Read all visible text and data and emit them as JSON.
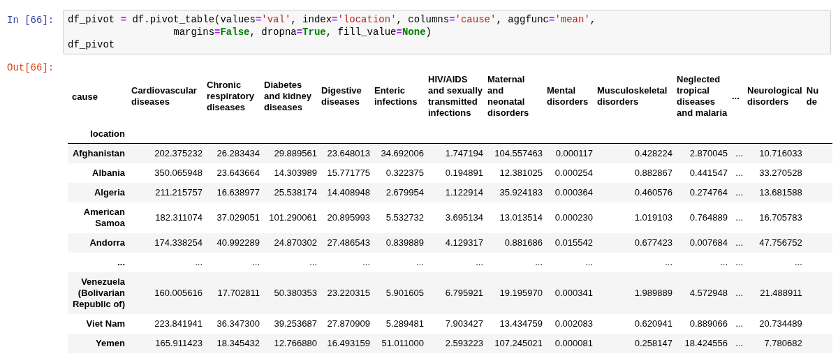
{
  "input_prompt": "In [66]:",
  "code_lines": [
    [
      {
        "kind": "plain",
        "text": "df_pivot "
      },
      {
        "kind": "op",
        "text": "="
      },
      {
        "kind": "plain",
        "text": " df.pivot_table(values"
      },
      {
        "kind": "op",
        "text": "="
      },
      {
        "kind": "str",
        "text": "'val'"
      },
      {
        "kind": "plain",
        "text": ", index"
      },
      {
        "kind": "op",
        "text": "="
      },
      {
        "kind": "str",
        "text": "'location'"
      },
      {
        "kind": "plain",
        "text": ", columns"
      },
      {
        "kind": "op",
        "text": "="
      },
      {
        "kind": "str",
        "text": "'cause'"
      },
      {
        "kind": "plain",
        "text": ", aggfunc"
      },
      {
        "kind": "op",
        "text": "="
      },
      {
        "kind": "str",
        "text": "'mean'"
      },
      {
        "kind": "plain",
        "text": ","
      }
    ],
    [
      {
        "kind": "plain",
        "text": "                  margins"
      },
      {
        "kind": "op",
        "text": "="
      },
      {
        "kind": "kw",
        "text": "False"
      },
      {
        "kind": "plain",
        "text": ", dropna"
      },
      {
        "kind": "op",
        "text": "="
      },
      {
        "kind": "kw",
        "text": "True"
      },
      {
        "kind": "plain",
        "text": ", fill_value"
      },
      {
        "kind": "op",
        "text": "="
      },
      {
        "kind": "kw",
        "text": "None"
      },
      {
        "kind": "plain",
        "text": ")"
      }
    ],
    [
      {
        "kind": "plain",
        "text": "df_pivot"
      }
    ]
  ],
  "output_prompt": "Out[66]:",
  "table": {
    "columns_name": "cause",
    "index_name": "location",
    "columns": [
      "Cardiovascular diseases",
      "Chronic respiratory diseases",
      "Diabetes and kidney diseases",
      "Digestive diseases",
      "Enteric infections",
      "HIV/AIDS and sexually transmitted infections",
      "Maternal and neonatal disorders",
      "Mental disorders",
      "Musculoskeletal disorders",
      "Neglected tropical diseases and malaria",
      "...",
      "Neurological disorders",
      "Nu de"
    ],
    "rows": [
      {
        "location": "Afghanistan",
        "values": [
          "202.375232",
          "26.283434",
          "29.889561",
          "23.648013",
          "34.692006",
          "1.747194",
          "104.557463",
          "0.000117",
          "0.428224",
          "2.870045",
          "...",
          "10.716033"
        ]
      },
      {
        "location": "Albania",
        "values": [
          "350.065948",
          "23.643664",
          "14.303989",
          "15.771775",
          "0.322375",
          "0.194891",
          "12.381025",
          "0.000254",
          "0.882867",
          "0.441547",
          "...",
          "33.270528"
        ]
      },
      {
        "location": "Algeria",
        "values": [
          "211.215757",
          "16.638977",
          "25.538174",
          "14.408948",
          "2.679954",
          "1.122914",
          "35.924183",
          "0.000364",
          "0.460576",
          "0.274764",
          "...",
          "13.681588"
        ]
      },
      {
        "location": "American Samoa",
        "values": [
          "182.311074",
          "37.029051",
          "101.290061",
          "20.895993",
          "5.532732",
          "3.695134",
          "13.013514",
          "0.000230",
          "1.019103",
          "0.764889",
          "...",
          "16.705783"
        ]
      },
      {
        "location": "Andorra",
        "values": [
          "174.338254",
          "40.992289",
          "24.870302",
          "27.486543",
          "0.839889",
          "4.129317",
          "0.881686",
          "0.015542",
          "0.677423",
          "0.007684",
          "...",
          "47.756752"
        ]
      },
      {
        "location": "...",
        "values": [
          "...",
          "...",
          "...",
          "...",
          "...",
          "...",
          "...",
          "...",
          "...",
          "...",
          "...",
          "..."
        ]
      },
      {
        "location": "Venezuela (Bolivarian Republic of)",
        "values": [
          "160.005616",
          "17.702811",
          "50.380353",
          "23.220315",
          "5.901605",
          "6.795921",
          "19.195970",
          "0.000341",
          "1.989889",
          "4.572948",
          "...",
          "21.488911"
        ]
      },
      {
        "location": "Viet Nam",
        "values": [
          "223.841941",
          "36.347300",
          "39.253687",
          "27.870909",
          "5.289481",
          "7.903427",
          "13.434759",
          "0.002083",
          "0.620941",
          "0.889066",
          "...",
          "20.734489"
        ]
      },
      {
        "location": "Yemen",
        "values": [
          "165.911423",
          "18.345432",
          "12.766880",
          "16.493159",
          "51.011000",
          "2.593223",
          "107.245021",
          "0.000081",
          "0.258147",
          "18.424556",
          "...",
          "7.780682"
        ]
      }
    ]
  }
}
